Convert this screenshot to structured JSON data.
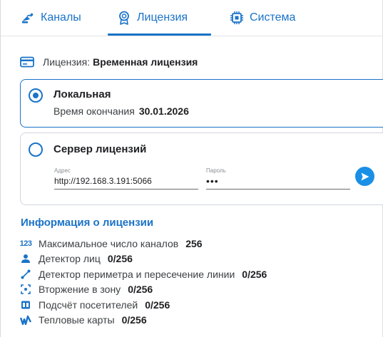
{
  "tabs": [
    {
      "label": "Каналы",
      "icon": "satellite-dish-icon"
    },
    {
      "label": "Лицензия",
      "icon": "award-icon",
      "active": true
    },
    {
      "label": "Система",
      "icon": "cpu-chip-icon"
    }
  ],
  "license": {
    "label": "Лицензия:",
    "value": "Временная лицензия"
  },
  "local": {
    "title": "Локальная",
    "expiry_label": "Время окончания",
    "expiry_value": "30.01.2026",
    "selected": true
  },
  "server": {
    "title": "Сервер лицензий",
    "address_label": "Адрес",
    "address_value": "http://192.168.3.191:5066",
    "password_label": "Пароль",
    "password_value": "•••",
    "selected": false
  },
  "info": {
    "title": "Информация о лицензии",
    "items": [
      {
        "icon": "123-icon",
        "label": "Максимальное число каналов",
        "value": "256"
      },
      {
        "icon": "person-icon",
        "label": "Детектор лиц",
        "value": "0/256"
      },
      {
        "icon": "line-crossing-icon",
        "label": "Детектор периметра и пересечение линии",
        "value": "0/256"
      },
      {
        "icon": "zone-intrusion-icon",
        "label": "Вторжение в зону",
        "value": "0/256"
      },
      {
        "icon": "counter-icon",
        "label": "Подсчёт посетителей",
        "value": "0/256"
      },
      {
        "icon": "heatmap-icon",
        "label": "Тепловые карты",
        "value": "0/256"
      }
    ]
  },
  "colors": {
    "accent": "#1a73c8",
    "send_button": "#1a8fe6"
  }
}
